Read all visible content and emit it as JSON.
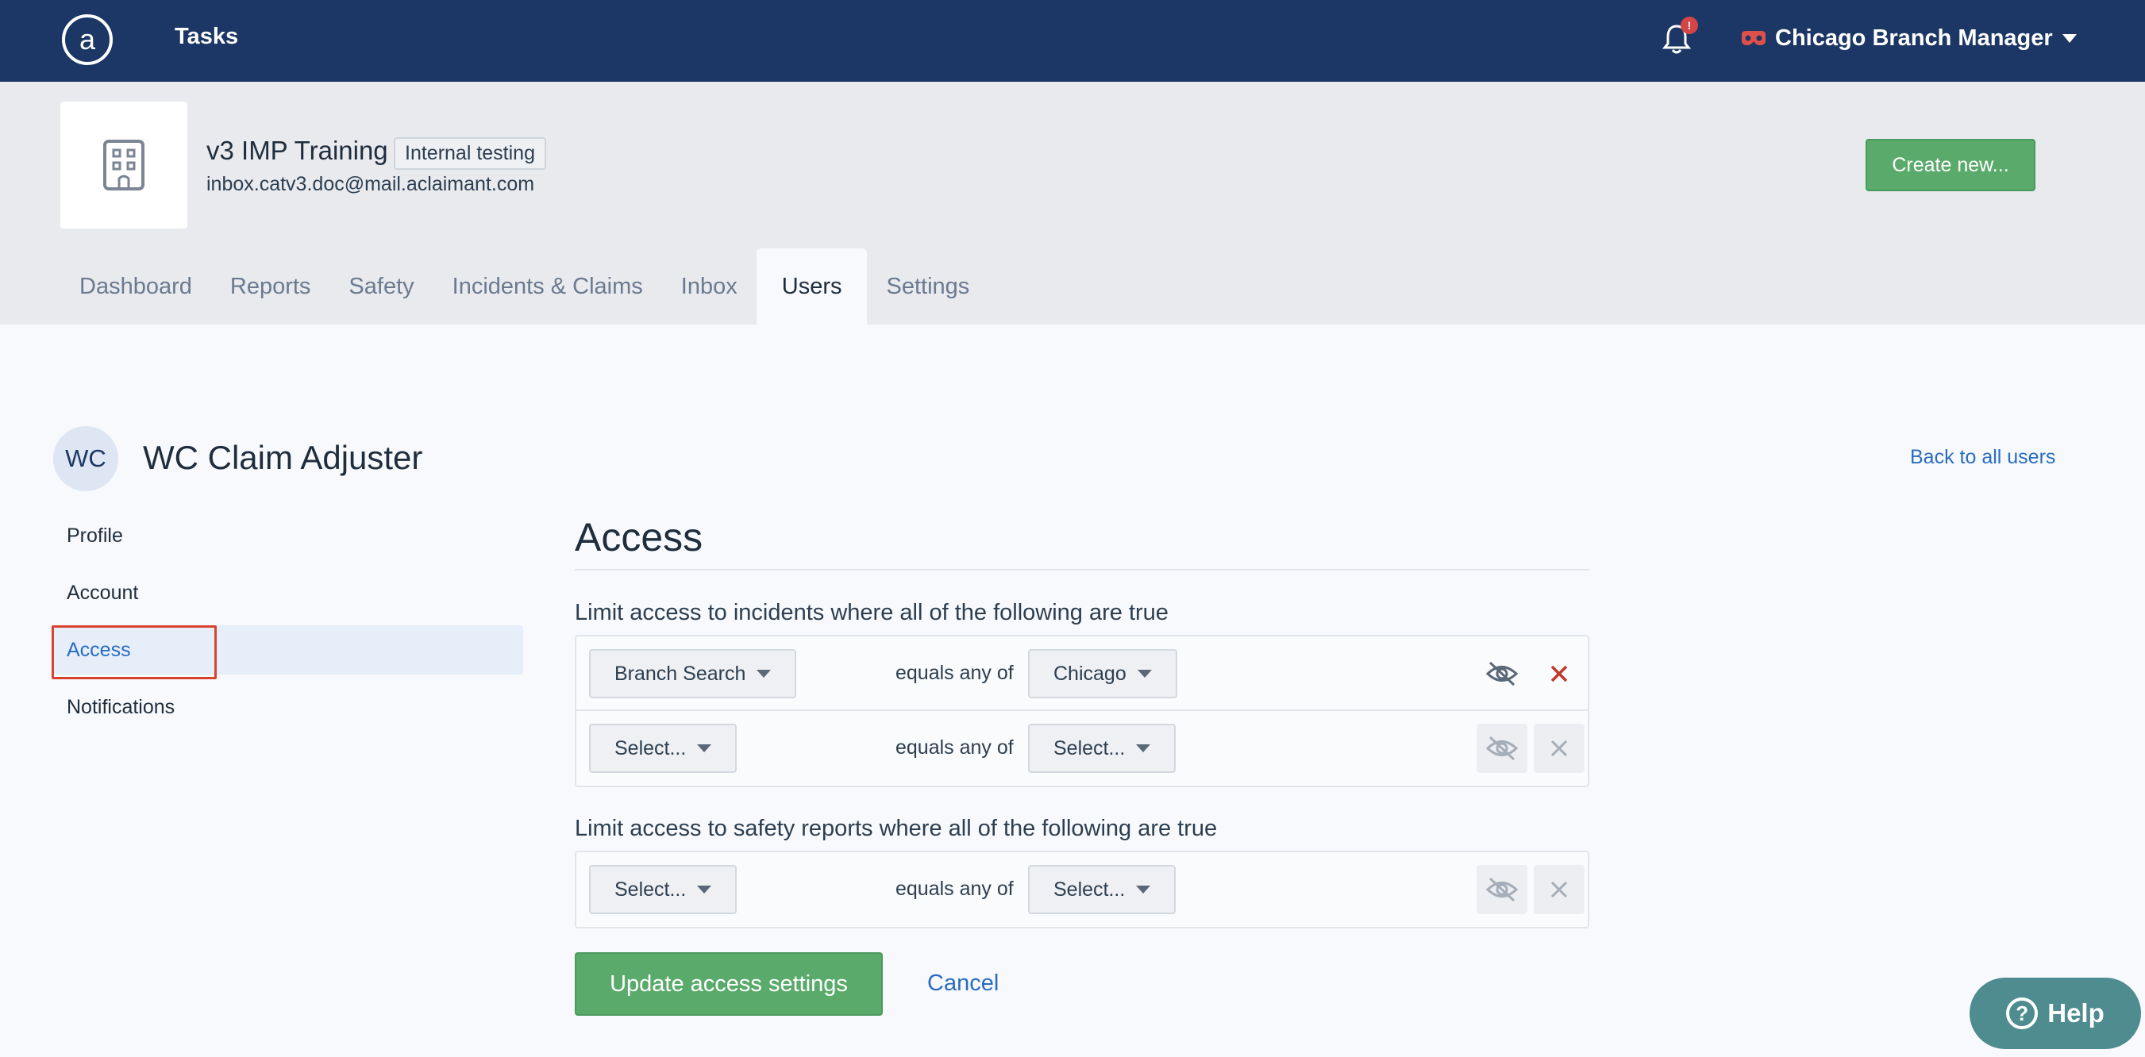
{
  "topnav": {
    "nav_label": "Tasks",
    "notification_badge": "!",
    "user_menu_label": "Chicago Branch Manager"
  },
  "org": {
    "name": "v3 IMP Training",
    "tag": "Internal testing",
    "email": "inbox.catv3.doc@mail.aclaimant.com",
    "create_button": "Create new..."
  },
  "tabs": [
    {
      "label": "Dashboard",
      "active": false
    },
    {
      "label": "Reports",
      "active": false
    },
    {
      "label": "Safety",
      "active": false
    },
    {
      "label": "Incidents & Claims",
      "active": false
    },
    {
      "label": "Inbox",
      "active": false
    },
    {
      "label": "Users",
      "active": true
    },
    {
      "label": "Settings",
      "active": false
    }
  ],
  "user": {
    "initials": "WC",
    "name": "WC Claim Adjuster",
    "back_link": "Back to all users"
  },
  "sidenav": [
    {
      "label": "Profile",
      "active": false
    },
    {
      "label": "Account",
      "active": false
    },
    {
      "label": "Access",
      "active": true
    },
    {
      "label": "Notifications",
      "active": false
    }
  ],
  "access": {
    "title": "Access",
    "incidents_label": "Limit access to incidents where all of the following are true",
    "incident_rows": [
      {
        "field": "Branch Search",
        "operator": "equals any of",
        "value": "Chicago",
        "enabled": true
      },
      {
        "field": "Select...",
        "operator": "equals any of",
        "value": "Select...",
        "enabled": false
      }
    ],
    "safety_label": "Limit access to safety reports where all of the following are true",
    "safety_rows": [
      {
        "field": "Select...",
        "operator": "equals any of",
        "value": "Select...",
        "enabled": false
      }
    ],
    "update_button": "Update access settings",
    "cancel_link": "Cancel"
  },
  "help": {
    "label": "Help"
  },
  "colors": {
    "nav_bg": "#1c3766",
    "primary_green": "#5aab6b",
    "link_blue": "#2a6cc0",
    "danger_red": "#c0392b",
    "highlight_red": "#d9422f"
  }
}
